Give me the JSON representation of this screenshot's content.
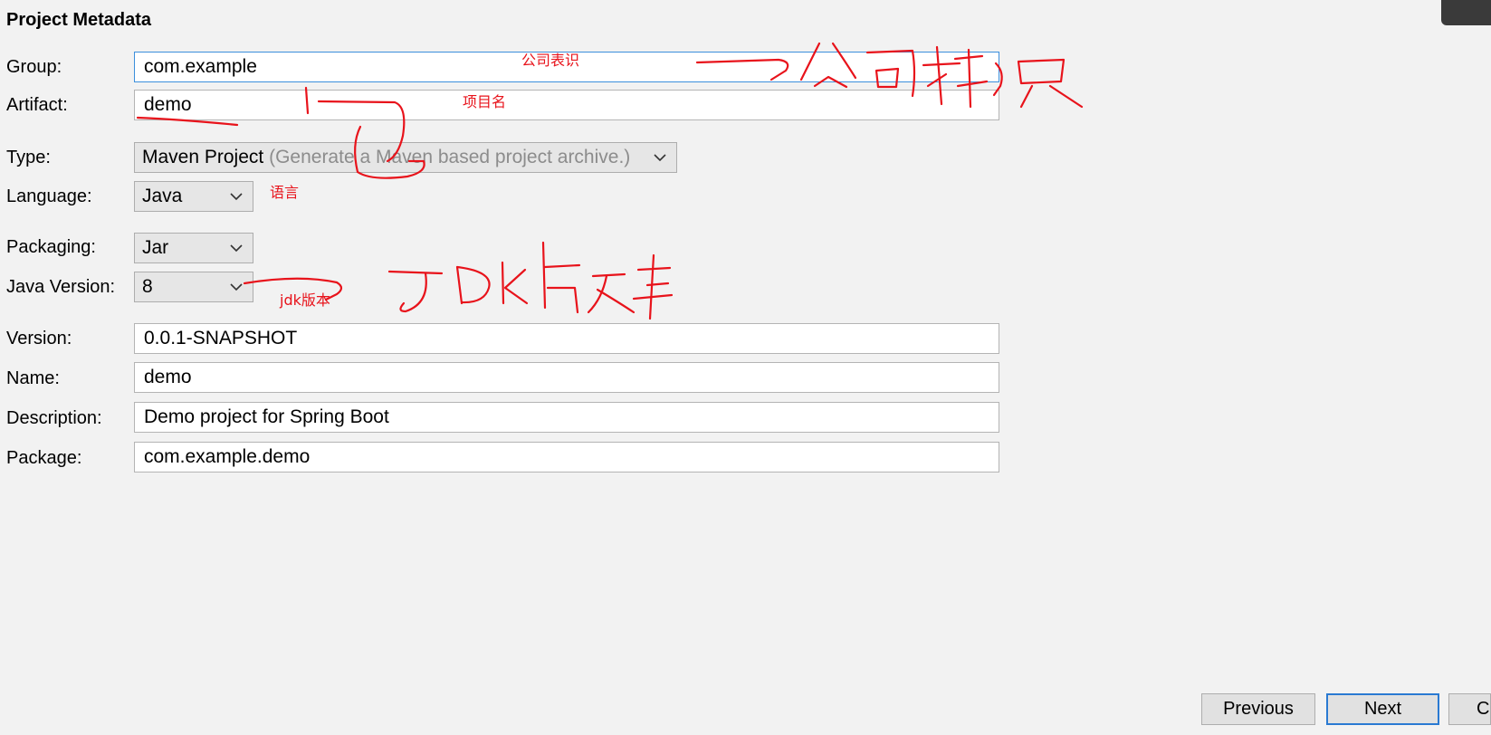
{
  "header": {
    "title": "Project Metadata"
  },
  "form": {
    "group": {
      "label": "Group:",
      "value": "com.example"
    },
    "artifact": {
      "label": "Artifact:",
      "value": "demo"
    },
    "type": {
      "label": "Type:",
      "selected": "Maven Project",
      "hint": "(Generate a Maven based project archive.)"
    },
    "language": {
      "label": "Language:",
      "selected": "Java"
    },
    "packaging": {
      "label": "Packaging:",
      "selected": "Jar"
    },
    "java_version": {
      "label": "Java Version:",
      "selected": "8"
    },
    "version": {
      "label": "Version:",
      "value": "0.0.1-SNAPSHOT"
    },
    "name": {
      "label": "Name:",
      "value": "demo"
    },
    "description": {
      "label": "Description:",
      "value": "Demo project for Spring Boot"
    },
    "package": {
      "label": "Package:",
      "value": "com.example.demo"
    }
  },
  "annotations": {
    "company_id": "公司表识",
    "project_name": "项目名",
    "language": "语言",
    "jdk_version": "jdk版本",
    "ink_color": "#e8131b"
  },
  "footer": {
    "previous_label": "Previous",
    "next_label": "Next",
    "cancel_label": "Ca"
  },
  "colors": {
    "background": "#f2f2f2",
    "focus_border": "#3c8fdc",
    "default_button_border": "#2a7ad2"
  }
}
